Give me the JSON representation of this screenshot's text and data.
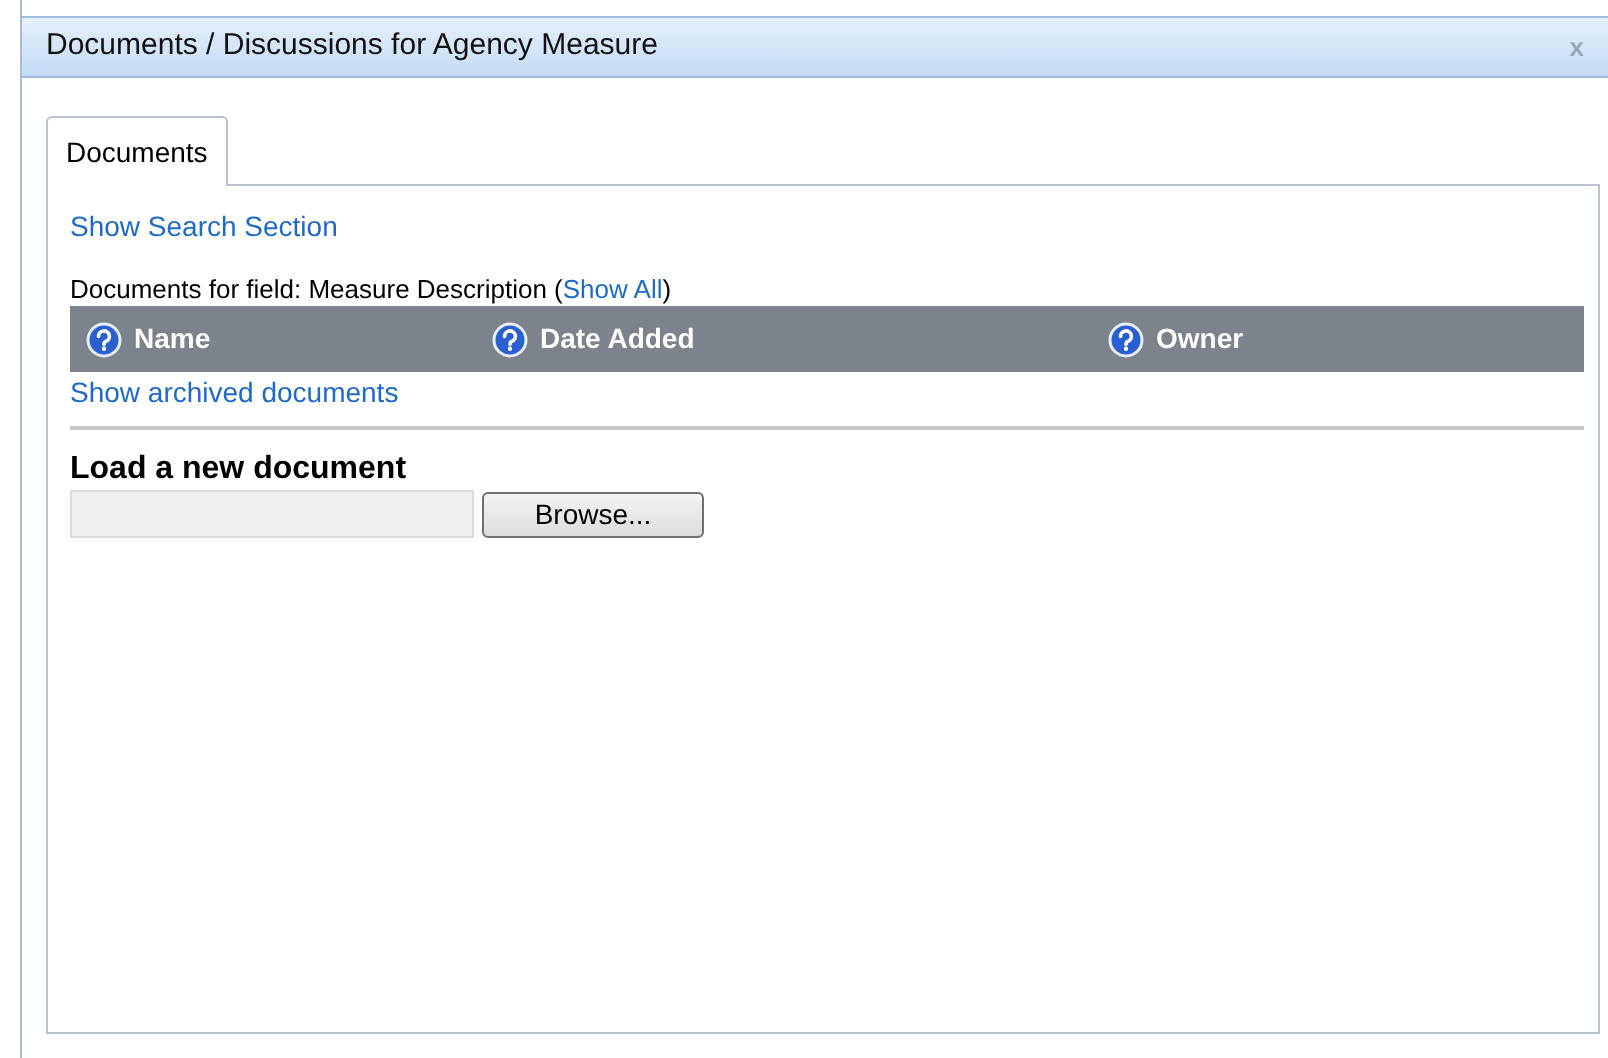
{
  "window": {
    "title": "Documents / Discussions for Agency Measure",
    "close": "x"
  },
  "tabs": [
    {
      "label": "Documents",
      "selected": true
    }
  ],
  "search_link": "Show Search Section",
  "caption": {
    "prefix": "Documents for field: Measure Description (",
    "link": "Show All",
    "suffix": ")"
  },
  "table": {
    "columns": [
      {
        "label": "Name"
      },
      {
        "label": "Date Added"
      },
      {
        "label": "Owner"
      }
    ]
  },
  "archived_link": "Show archived documents",
  "upload": {
    "heading": "Load a new document",
    "button": "Browse..."
  }
}
